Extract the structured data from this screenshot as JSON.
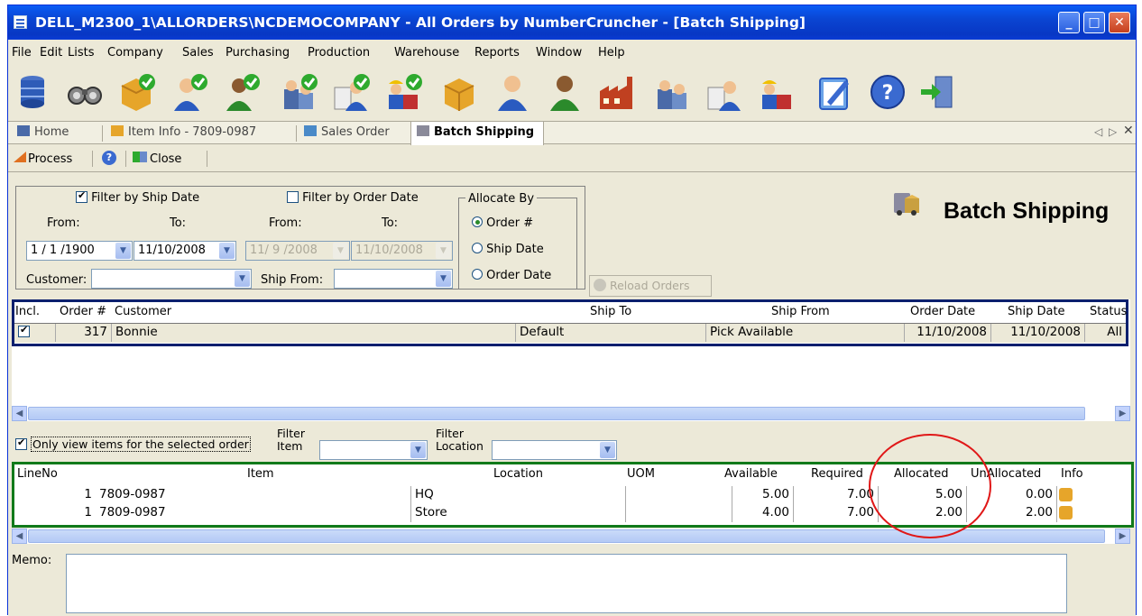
{
  "window": {
    "title": "DELL_M2300_1\\ALLORDERS\\NCDEMOCOMPANY - All Orders by NumberCruncher - [Batch Shipping]"
  },
  "menu": [
    "File",
    "Edit",
    "Lists",
    "Company",
    "Sales",
    "Purchasing",
    "Production",
    "Warehouse",
    "Reports",
    "Window",
    "Help"
  ],
  "toolbar_icons": [
    "database-icon",
    "binoculars-icon",
    "box-check-icon",
    "user-check-icon",
    "user-green-check-icon",
    "user-group-check-icon",
    "user-list-check-icon",
    "workers-check-icon",
    "box-icon",
    "user-icon",
    "user-green-icon",
    "factory-icon",
    "user-group-icon",
    "user-list-icon",
    "workers-icon",
    "edit-icon",
    "help-icon",
    "exit-icon"
  ],
  "tabs": {
    "home": "Home",
    "item_info": "Item Info - 7809-0987",
    "sales_order": "Sales Order",
    "batch_shipping": "Batch Shipping"
  },
  "commands": {
    "process": "Process",
    "close": "Close"
  },
  "filters": {
    "filter_ship_date": "Filter by Ship Date",
    "filter_order_date": "Filter by Order Date",
    "from": "From:",
    "to": "To:",
    "ship_from_date": "1 / 1 /1900",
    "ship_to_date": "11/10/2008",
    "order_from_date": "11/ 9 /2008",
    "order_to_date": "11/10/2008",
    "customer_label": "Customer:",
    "ship_from_label": "Ship From:",
    "allocate_by": "Allocate By",
    "radio_order": "Order #",
    "radio_ship_date": "Ship Date",
    "radio_order_date": "Order Date",
    "reload": "Reload Orders"
  },
  "heading": "Batch Shipping",
  "orders": {
    "columns": {
      "incl": "Incl.",
      "order": "Order #",
      "customer": "Customer",
      "ship_to": "Ship To",
      "ship_from": "Ship From",
      "order_date": "Order Date",
      "ship_date": "Ship Date",
      "status": "Status"
    },
    "rows": [
      {
        "order": "317",
        "customer": "Bonnie",
        "ship_to": "Default",
        "ship_from": "Pick Available",
        "order_date": "11/10/2008",
        "ship_date": "11/10/2008",
        "status": "All"
      }
    ]
  },
  "item_filter": {
    "only_selected": "Only view items for the selected order",
    "filter_item_1": "Filter",
    "filter_item_2": "Item",
    "filter_loc_1": "Filter",
    "filter_loc_2": "Location"
  },
  "items": {
    "columns": {
      "line": "LineNo",
      "item": "Item",
      "location": "Location",
      "uom": "UOM",
      "available": "Available",
      "required": "Required",
      "allocated": "Allocated",
      "unallocated": "UnAllocated",
      "info": "Info"
    },
    "rows": [
      {
        "line": "1",
        "item": "7809-0987",
        "location": "HQ",
        "uom": "",
        "available": "5.00",
        "required": "7.00",
        "allocated": "5.00",
        "unallocated": "0.00"
      },
      {
        "line": "1",
        "item": "7809-0987",
        "location": "Store",
        "uom": "",
        "available": "4.00",
        "required": "7.00",
        "allocated": "2.00",
        "unallocated": "2.00"
      }
    ]
  },
  "memo_label": "Memo:",
  "colors": {
    "title_blue": "#0a45d2",
    "orders_border": "#0a1f6e",
    "items_border": "#117a1a",
    "annotation": "#e01818"
  }
}
